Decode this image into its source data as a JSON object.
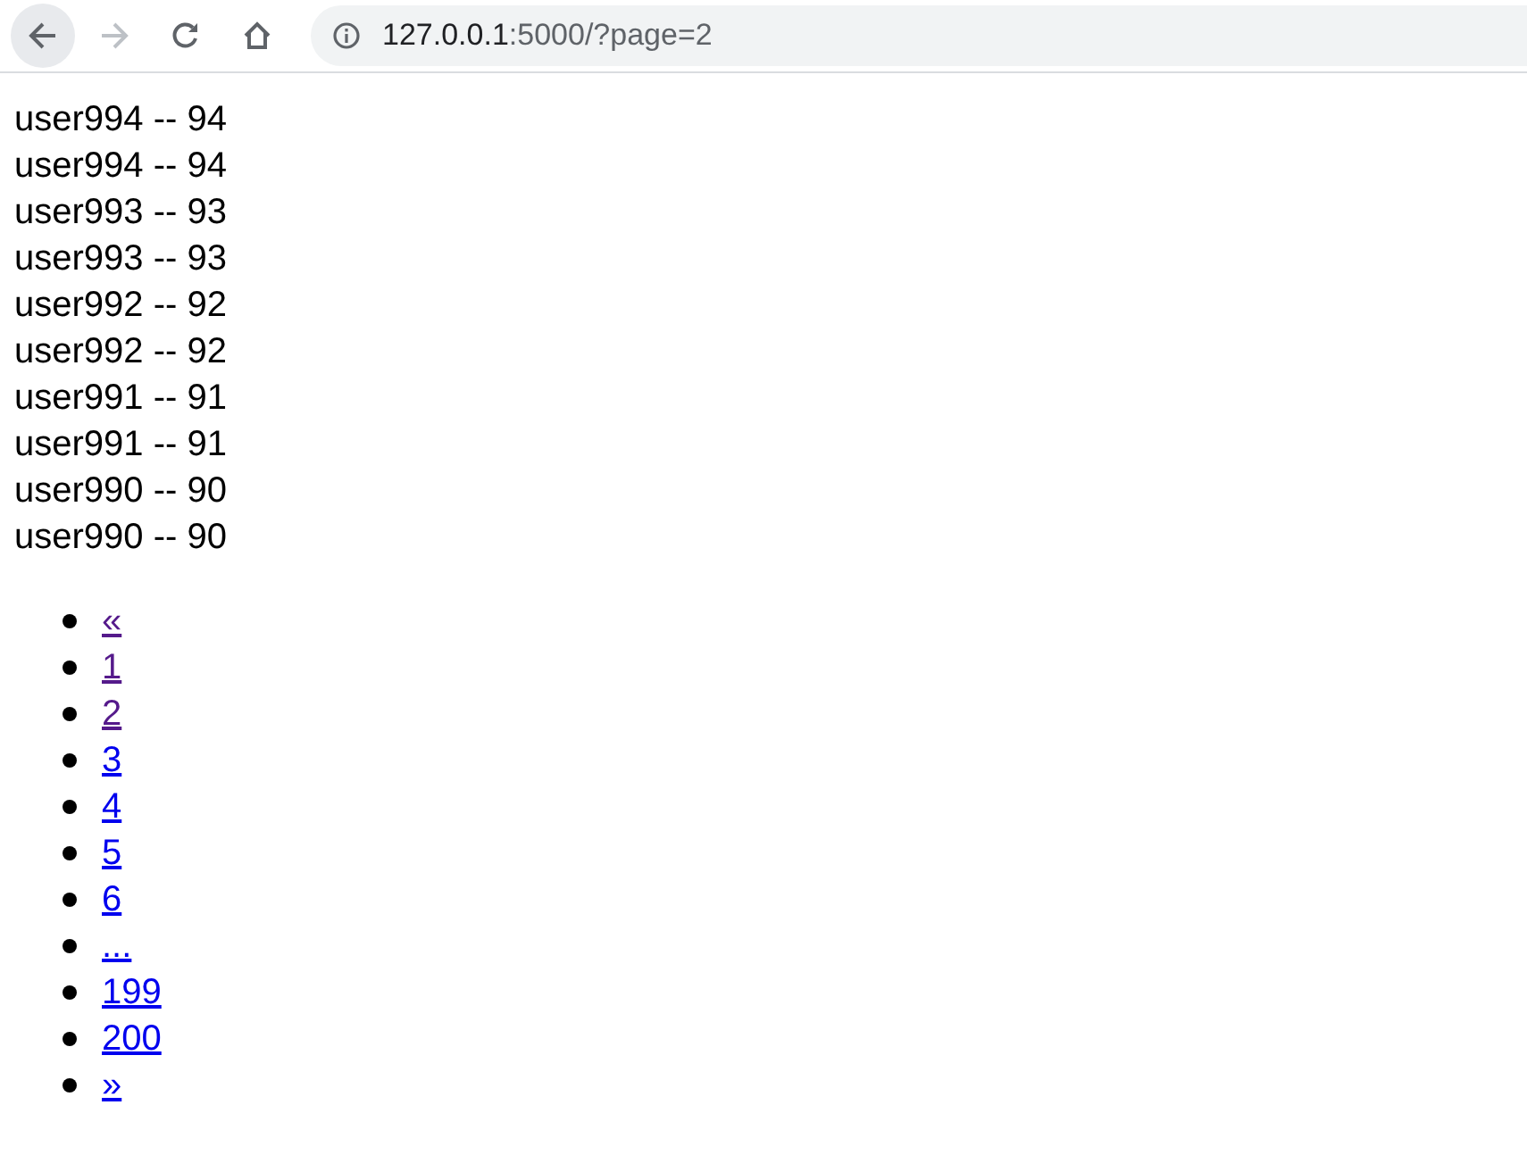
{
  "toolbar": {
    "back": {
      "disabled": false,
      "hovered": true
    },
    "forward": {
      "disabled": true
    }
  },
  "address": {
    "host": "127.0.0.1",
    "rest": ":5000/?page=2"
  },
  "lines": [
    "user994 -- 94",
    "user994 -- 94",
    "user993 -- 93",
    "user993 -- 93",
    "user992 -- 92",
    "user992 -- 92",
    "user991 -- 91",
    "user991 -- 91",
    "user990 -- 90",
    "user990 -- 90"
  ],
  "pagination": [
    {
      "label": "«",
      "visited": true
    },
    {
      "label": "1",
      "visited": true
    },
    {
      "label": "2",
      "visited": true
    },
    {
      "label": "3",
      "visited": false
    },
    {
      "label": "4",
      "visited": false
    },
    {
      "label": "5",
      "visited": false
    },
    {
      "label": "6",
      "visited": false
    },
    {
      "label": "...",
      "visited": false
    },
    {
      "label": "199",
      "visited": false
    },
    {
      "label": "200",
      "visited": false
    },
    {
      "label": "»",
      "visited": false
    }
  ]
}
